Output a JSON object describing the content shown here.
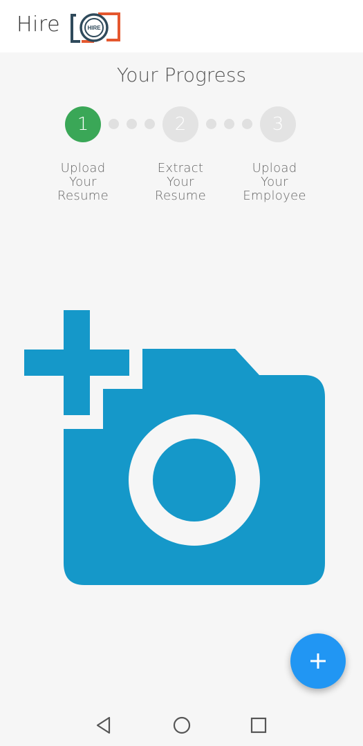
{
  "appbar": {
    "title": "Hire",
    "logo_text": "HIRE"
  },
  "progress": {
    "title": "Your Progress",
    "steps": [
      {
        "number": "1",
        "label_lines": [
          "Upload",
          "Your",
          "Resume"
        ],
        "status": "active"
      },
      {
        "number": "2",
        "label_lines": [
          "Extract",
          "Your",
          "Resume"
        ],
        "status": "inactive"
      },
      {
        "number": "3",
        "label_lines": [
          "Upload",
          "Your",
          "Employee"
        ],
        "status": "inactive"
      }
    ]
  },
  "colors": {
    "active_step": "#3aa757",
    "inactive_step": "#e3e3e3",
    "camera_icon": "#1598c9",
    "fab": "#2196f3",
    "logo_dark": "#2f4a5b",
    "logo_accent": "#e4572e"
  },
  "icons": {
    "main": "add-photo-camera-icon",
    "fab": "plus-icon",
    "nav": [
      "back-triangle-icon",
      "home-circle-icon",
      "recents-square-icon"
    ]
  }
}
